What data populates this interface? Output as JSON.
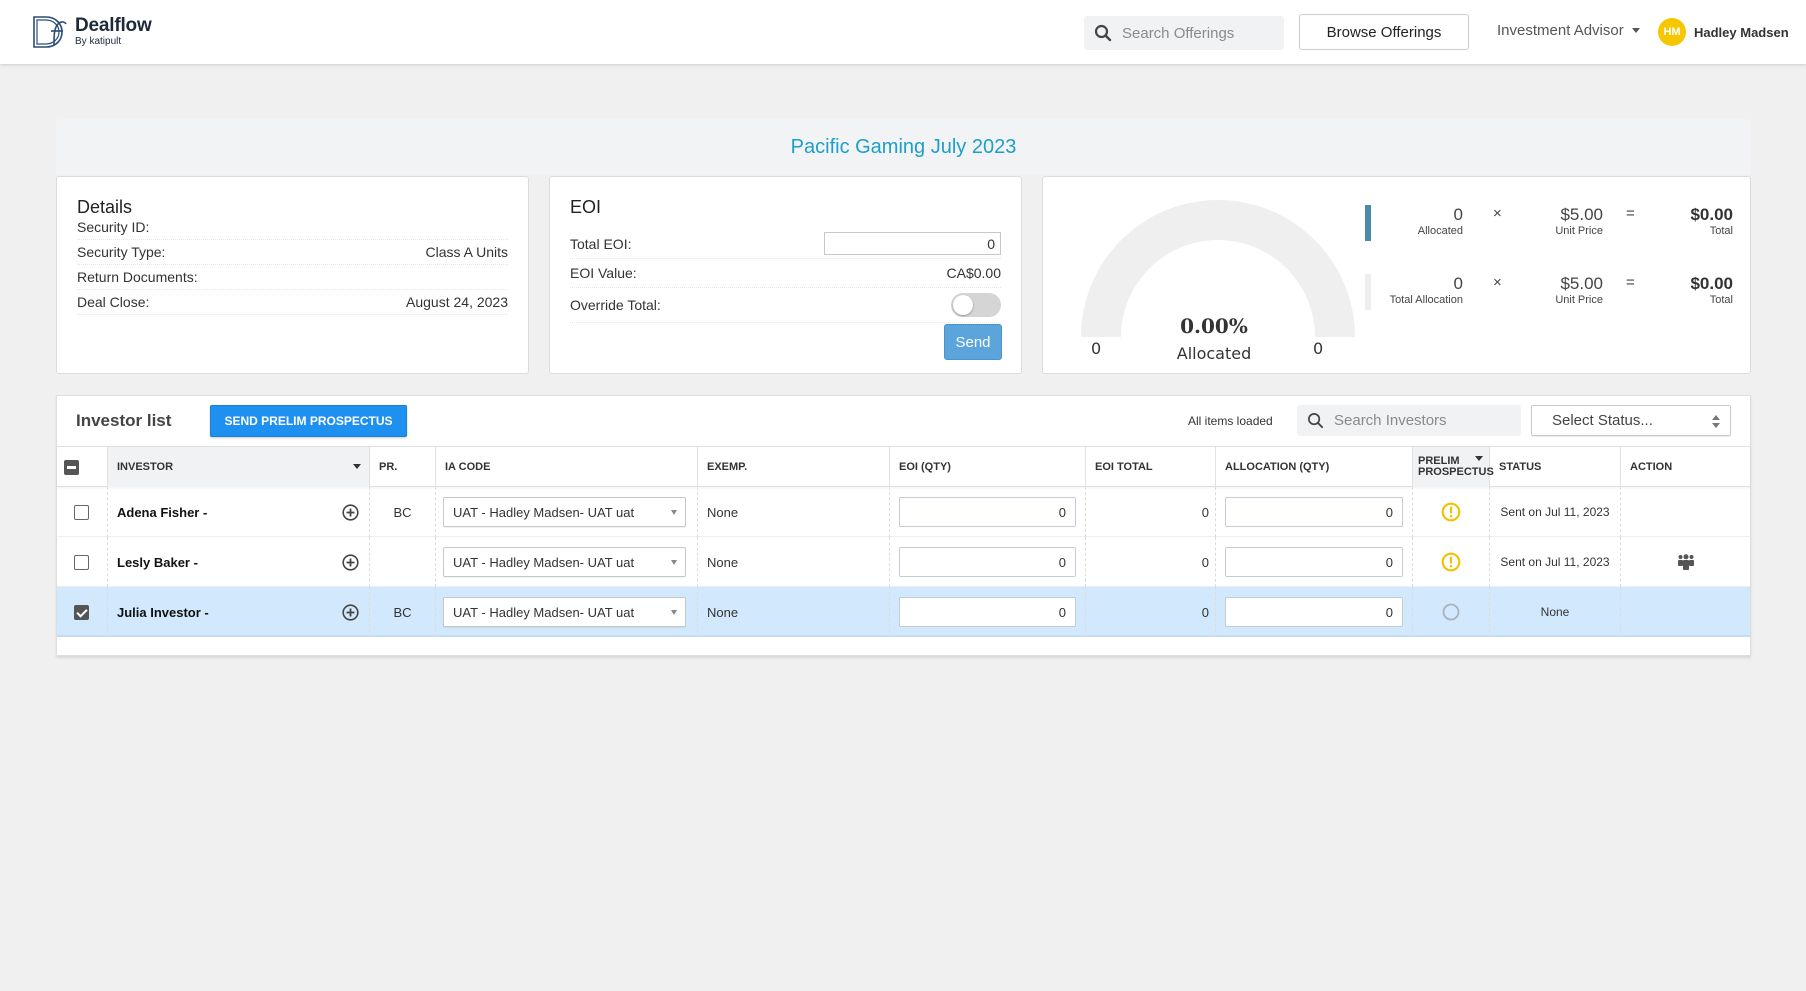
{
  "nav": {
    "brand_title": "Dealflow",
    "brand_sub": "By katipult",
    "search_placeholder": "Search Offerings",
    "browse_label": "Browse Offerings",
    "role_label": "Investment Advisor",
    "user_initials": "HM",
    "user_name": "Hadley Madsen",
    "avatar_color": "#f6c700"
  },
  "page_title": "Pacific Gaming July 2023",
  "details": {
    "heading": "Details",
    "rows": [
      {
        "label": "Security ID:",
        "value": ""
      },
      {
        "label": "Security Type:",
        "value": "Class A Units"
      },
      {
        "label": "Return Documents:",
        "value": ""
      },
      {
        "label": "Deal Close:",
        "value": "August 24, 2023"
      }
    ]
  },
  "eoi": {
    "heading": "EOI",
    "total_label": "Total EOI:",
    "total_value": "0",
    "value_label": "EOI Value:",
    "value_value": "CA$0.00",
    "override_label": "Override Total:",
    "override_on": false,
    "send_label": "Send"
  },
  "allocation": {
    "percent_text": "0.00%",
    "percent_value": 0,
    "gauge_label": "Allocated",
    "gauge_min": "0",
    "gauge_max": "0",
    "rows": [
      {
        "qty": "0",
        "qty_label": "Allocated",
        "times": "×",
        "price": "$5.00",
        "price_label": "Unit Price",
        "equals": "=",
        "total": "$0.00",
        "total_label": "Total",
        "bar_color": "#4a8aa5"
      },
      {
        "qty": "0",
        "qty_label": "Total Allocation",
        "times": "×",
        "price": "$5.00",
        "price_label": "Unit Price",
        "equals": "=",
        "total": "$0.00",
        "total_label": "Total",
        "bar_color": "#eeeeee"
      }
    ]
  },
  "investor_list": {
    "title": "Investor list",
    "send_prelim_label": "SEND PRELIM PROSPECTUS",
    "loaded_text": "All items loaded",
    "search_placeholder": "Search Investors",
    "status_placeholder": "Select Status...",
    "columns": [
      "INVESTOR",
      "PR.",
      "IA CODE",
      "EXEMP.",
      "EOI (QTY)",
      "EOI TOTAL",
      "ALLOCATION (QTY)",
      "PRELIM PROSPECTUS",
      "STATUS",
      "ACTION"
    ],
    "prelim_col": {
      "line1": "PRELIM",
      "line2": "PROSPECTUS"
    },
    "rows": [
      {
        "checked": false,
        "name": "Adena Fisher -",
        "pr": "BC",
        "ia_code": "UAT - Hadley Madsen- UAT uat",
        "exemp": "None",
        "eoi_qty": "0",
        "eoi_total": "0",
        "allocation_qty": "0",
        "prelim_status": "warning",
        "status": "Sent on Jul 11, 2023",
        "action": ""
      },
      {
        "checked": false,
        "name": "Lesly Baker -",
        "pr": "",
        "ia_code": "UAT - Hadley Madsen- UAT uat",
        "exemp": "None",
        "eoi_qty": "0",
        "eoi_total": "0",
        "allocation_qty": "0",
        "prelim_status": "warning",
        "status": "Sent on Jul 11, 2023",
        "action": "users-icon"
      },
      {
        "checked": true,
        "name": "Julia Investor -",
        "pr": "BC",
        "ia_code": "UAT - Hadley Madsen- UAT uat",
        "exemp": "None",
        "eoi_qty": "0",
        "eoi_total": "0",
        "allocation_qty": "0",
        "prelim_status": "none",
        "status": "None",
        "action": ""
      }
    ]
  },
  "colors": {
    "accent": "#1d9fc9",
    "primary_button": "#1e90f0",
    "send_button": "#5ba5dc",
    "warning": "#f2c200",
    "selected_row": "#d2e8fc"
  }
}
